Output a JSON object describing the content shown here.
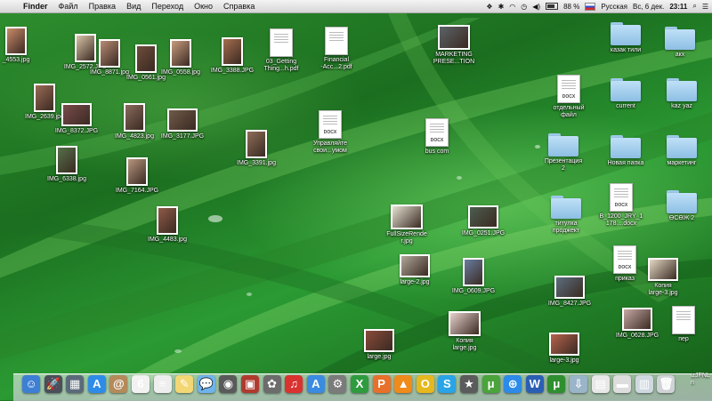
{
  "menubar": {
    "app_name": "Finder",
    "menus": [
      "Файл",
      "Правка",
      "Вид",
      "Переход",
      "Окно",
      "Справка"
    ],
    "battery_percent": "88 %",
    "battery_level": 0.88,
    "input_language": "Русская",
    "date": "Вс, 6 дек.",
    "time": "23:11"
  },
  "desktop_items": [
    {
      "label": "_4553.jpg",
      "kind": "photo-p",
      "color": "#c98b6a"
    },
    {
      "label": "IMG_2572.JPG",
      "kind": "photo-p",
      "color": "#d9c4a8"
    },
    {
      "label": "IMG_8871.jpg",
      "kind": "photo-p",
      "color": "#b88b73"
    },
    {
      "label": "IMG_0561.jpg",
      "kind": "photo-p",
      "color": "#6d4c3b"
    },
    {
      "label": "IMG_0558.jpg",
      "kind": "photo-p",
      "color": "#c79c7e"
    },
    {
      "label": "IMG_3388.JPG",
      "kind": "photo-p",
      "color": "#a56d4f"
    },
    {
      "label": "03_Getting\nThing...h.pdf",
      "kind": "doc",
      "tag": ""
    },
    {
      "label": "Financial\n-Acc...2.pdf",
      "kind": "doc",
      "tag": ""
    },
    {
      "label": "MARKETING\nPRESE...TION",
      "kind": "photo-xl",
      "color": "#5c6368"
    },
    {
      "label": "казак тили",
      "kind": "folder"
    },
    {
      "label": "акх",
      "kind": "folder"
    },
    {
      "label": "IMG_2639.jpg",
      "kind": "photo-p",
      "color": "#9a6b55"
    },
    {
      "label": "IMG_8372.JPG",
      "kind": "photo-l",
      "color": "#7a4b4b"
    },
    {
      "label": "IMG_4823.jpg",
      "kind": "photo-p",
      "color": "#8a6a5c"
    },
    {
      "label": "IMG_3177.JPG",
      "kind": "photo-l",
      "color": "#6f5a48"
    },
    {
      "label": "IMG_3391.jpg",
      "kind": "photo-p",
      "color": "#8e6d57"
    },
    {
      "label": "Управляйте\nсвои...умом",
      "kind": "doc",
      "tag": "DOCX"
    },
    {
      "label": "bus com",
      "kind": "doc",
      "tag": "DOCX"
    },
    {
      "label": "отдельный\nфайл",
      "kind": "doc",
      "tag": "DOCX"
    },
    {
      "label": "current",
      "kind": "folder"
    },
    {
      "label": "kaz yaz",
      "kind": "folder"
    },
    {
      "label": "IMG_6338.jpg",
      "kind": "photo-p",
      "color": "#55704a"
    },
    {
      "label": "IMG_7164.JPG",
      "kind": "photo-p",
      "color": "#b7967e"
    },
    {
      "label": "Презентация\n2",
      "kind": "folder"
    },
    {
      "label": "Новая папка",
      "kind": "folder"
    },
    {
      "label": "маркетинг",
      "kind": "folder"
    },
    {
      "label": "IMG_4483.jpg",
      "kind": "photo-p",
      "color": "#8f5a47"
    },
    {
      "label": "FullSizeRende\nr.jpg",
      "kind": "photo-xl",
      "color": "#e6e2d2"
    },
    {
      "label": "IMG_0251.JPG",
      "kind": "photo-l",
      "color": "#4d5d4f"
    },
    {
      "label": "титулка\nпроджект",
      "kind": "folder"
    },
    {
      "label": "B_1200_JRY_1\n178....docx",
      "kind": "doc",
      "tag": "DOCX"
    },
    {
      "label": "ӨСӨЖ 2",
      "kind": "folder"
    },
    {
      "label": "large-2.jpg",
      "kind": "photo-l",
      "color": "#b0a79a"
    },
    {
      "label": "IMG_0609.JPG",
      "kind": "photo-p",
      "color": "#6a7da0"
    },
    {
      "label": "приказ",
      "kind": "doc",
      "tag": "DOCX"
    },
    {
      "label": "Копия\nlarge-3.jpg",
      "kind": "photo-l",
      "color": "#e3d8c4"
    },
    {
      "label": "IMG_8427.JPG",
      "kind": "photo-l",
      "color": "#5c6e7e"
    },
    {
      "label": "Копия\nlarge.jpg",
      "kind": "photo-xl",
      "color": "#e8d0cc"
    },
    {
      "label": "IMG_0628.JPG",
      "kind": "photo-l",
      "color": "#c7a9a5"
    },
    {
      "label": "пер",
      "kind": "doc",
      "tag": ""
    },
    {
      "label": "large.jpg",
      "kind": "photo-l",
      "color": "#8a4b3a"
    },
    {
      "label": "large-3.jpg",
      "kind": "photo-l",
      "color": "#b6624c"
    }
  ],
  "dock_items": [
    {
      "name": "finder-dock-icon",
      "glyph": "☺",
      "color": "#3d7fd4"
    },
    {
      "name": "launchpad-dock-icon",
      "glyph": "🚀",
      "color": "#4a4f5a"
    },
    {
      "name": "mission-control-dock-icon",
      "glyph": "▦",
      "color": "#5b6a7a"
    },
    {
      "name": "app-store-dock-icon",
      "glyph": "A",
      "color": "#2e8ce8"
    },
    {
      "name": "contacts-dock-icon",
      "glyph": "@",
      "color": "#b48a5a"
    },
    {
      "name": "calendar-dock-icon",
      "glyph": "6",
      "color": "#f2f2f2"
    },
    {
      "name": "reminders-dock-icon",
      "glyph": "≡",
      "color": "#eeeeee"
    },
    {
      "name": "notes-dock-icon",
      "glyph": "✎",
      "color": "#f2d774"
    },
    {
      "name": "messages-dock-icon",
      "glyph": "💬",
      "color": "#6fb3ec"
    },
    {
      "name": "facetime-dock-icon",
      "glyph": "◉",
      "color": "#5a5a5a"
    },
    {
      "name": "photo-booth-dock-icon",
      "glyph": "▣",
      "color": "#b03a2e"
    },
    {
      "name": "iphoto-dock-icon",
      "glyph": "✿",
      "color": "#6c6c6c"
    },
    {
      "name": "itunes-dock-icon",
      "glyph": "♫",
      "color": "#d9322f"
    },
    {
      "name": "app-store-blue-dock-icon",
      "glyph": "A",
      "color": "#3b8be0"
    },
    {
      "name": "system-preferences-dock-icon",
      "glyph": "⚙",
      "color": "#7b7b7b"
    },
    {
      "name": "excel-dock-icon",
      "glyph": "X",
      "color": "#2f9b3f"
    },
    {
      "name": "powerpoint-dock-icon",
      "glyph": "P",
      "color": "#e8702a"
    },
    {
      "name": "vlc-dock-icon",
      "glyph": "▲",
      "color": "#f08a1b"
    },
    {
      "name": "outlook-dock-icon",
      "glyph": "O",
      "color": "#e6b81e"
    },
    {
      "name": "skype-dock-icon",
      "glyph": "S",
      "color": "#2aa4e6"
    },
    {
      "name": "imovie-dock-icon",
      "glyph": "★",
      "color": "#5b5b5b"
    },
    {
      "name": "torrent-dock-icon",
      "glyph": "μ",
      "color": "#4aa33b"
    },
    {
      "name": "safari-dock-icon",
      "glyph": "⊕",
      "color": "#2c8be8"
    },
    {
      "name": "word-dock-icon",
      "glyph": "W",
      "color": "#2b5fb4"
    },
    {
      "name": "utorrent-dock-icon",
      "glyph": "μ",
      "color": "#2e8f2e"
    },
    {
      "name": "downloads-stack-dock-icon",
      "glyph": "⇩",
      "color": "#9ab4c8"
    },
    {
      "name": "documents-stack-dock-icon",
      "glyph": "▤",
      "color": "#e8e8e8"
    },
    {
      "name": "hard-drive-dock-icon",
      "glyph": "▬",
      "color": "#dddddd"
    },
    {
      "name": "stack-dock-icon",
      "glyph": "▥",
      "color": "#cfd8df"
    },
    {
      "name": "trash-dock-icon",
      "glyph": "🗑",
      "color": "#cfd3d6"
    }
  ],
  "dock_partial_label": "izJFNL\nn"
}
